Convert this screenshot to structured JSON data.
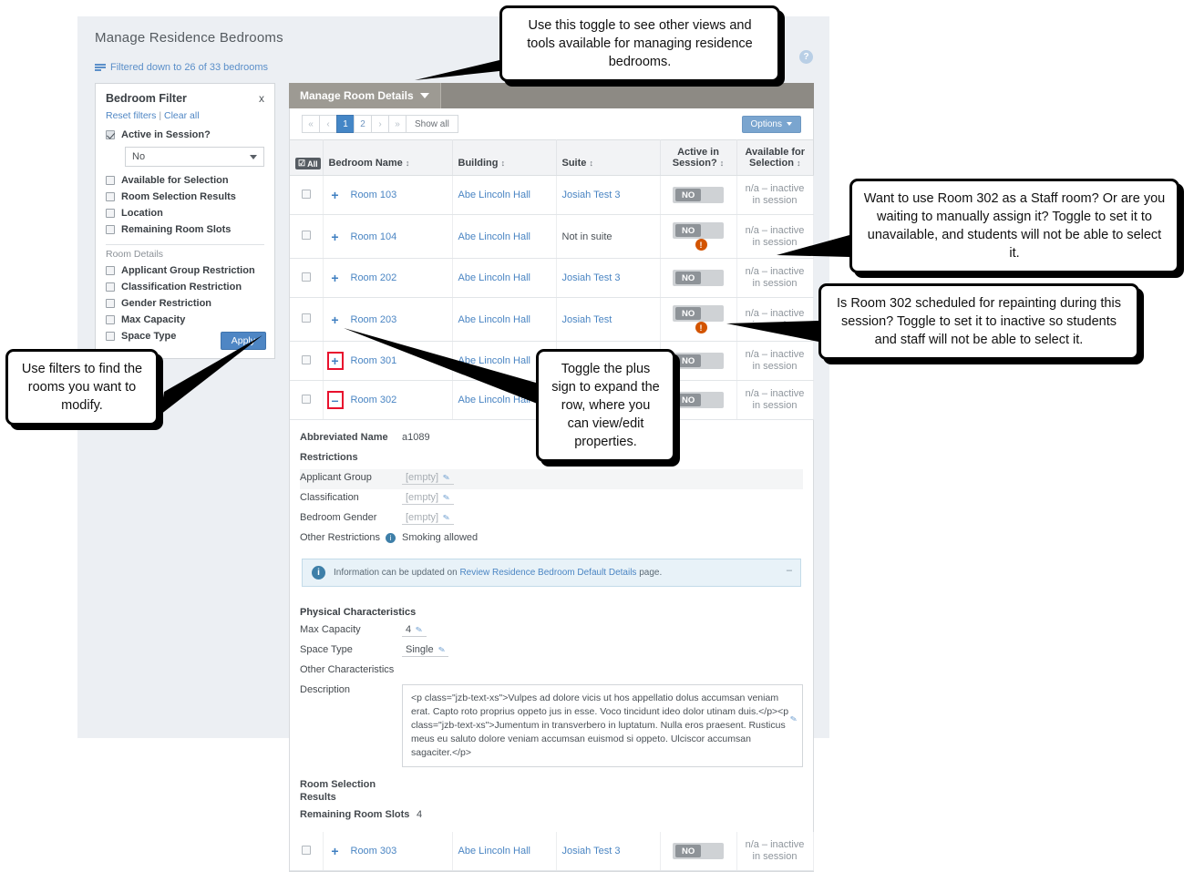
{
  "page": {
    "title": "Manage Residence Bedrooms",
    "filtered_note": "Filtered down to 26 of 33 bedrooms",
    "help_icon": "?"
  },
  "filter_card": {
    "title": "Bedroom Filter",
    "close_label": "x",
    "reset_label": "Reset filters",
    "separator": "|",
    "clear_label": "Clear all",
    "active_in_session": {
      "label": "Active in Session?",
      "checked": true,
      "value": "No"
    },
    "checkboxes": [
      {
        "label": "Available for Selection",
        "checked": false
      },
      {
        "label": "Room Selection Results",
        "checked": false
      },
      {
        "label": "Location",
        "checked": false
      },
      {
        "label": "Remaining Room Slots",
        "checked": false
      }
    ],
    "group_title": "Room Details",
    "detail_checkboxes": [
      {
        "label": "Applicant Group Restriction",
        "checked": false
      },
      {
        "label": "Classification Restriction",
        "checked": false
      },
      {
        "label": "Gender Restriction",
        "checked": false
      },
      {
        "label": "Max Capacity",
        "checked": false
      },
      {
        "label": "Space Type",
        "checked": false
      }
    ],
    "apply_label": "Apply"
  },
  "view_tab": {
    "label": "Manage Room Details"
  },
  "toolbar": {
    "pager": [
      {
        "label": "«",
        "state": "dim"
      },
      {
        "label": "‹",
        "state": "dim"
      },
      {
        "label": "1",
        "state": "active"
      },
      {
        "label": "2",
        "state": "normal"
      },
      {
        "label": "›",
        "state": "dim"
      },
      {
        "label": "»",
        "state": "dim"
      },
      {
        "label": "Show all",
        "state": "showall"
      }
    ],
    "options_label": "Options"
  },
  "grid": {
    "select_all_label": "All",
    "columns": [
      "Bedroom Name",
      "Building",
      "Suite",
      "Active in Session?",
      "Available for Selection"
    ],
    "rows": [
      {
        "expander": "+",
        "name": "Room 103",
        "building": "Abe Lincoln Hall",
        "suite": "Josiah Test 3",
        "suite_link": true,
        "toggle": "NO",
        "warn": false,
        "available": "n/a – inactive in session",
        "highlight_expander": false
      },
      {
        "expander": "+",
        "name": "Room 104",
        "building": "Abe Lincoln Hall",
        "suite": "Not in suite",
        "suite_link": false,
        "toggle": "NO",
        "warn": true,
        "available": "n/a – inactive in session",
        "highlight_expander": false
      },
      {
        "expander": "+",
        "name": "Room 202",
        "building": "Abe Lincoln Hall",
        "suite": "Josiah Test 3",
        "suite_link": true,
        "toggle": "NO",
        "warn": false,
        "available": "n/a – inactive in session",
        "highlight_expander": false
      },
      {
        "expander": "+",
        "name": "Room 203",
        "building": "Abe Lincoln Hall",
        "suite": "Josiah Test",
        "suite_link": true,
        "toggle": "NO",
        "warn": true,
        "available": "n/a – inactive in session",
        "highlight_expander": false
      },
      {
        "expander": "+",
        "name": "Room 301",
        "building": "Abe Lincoln Hall",
        "suite": "Josiah Test 3",
        "suite_link": true,
        "toggle": "NO",
        "warn": false,
        "available": "n/a – inactive in session",
        "highlight_expander": true
      },
      {
        "expander": "–",
        "name": "Room 302",
        "building": "Abe Lincoln Hall",
        "suite": "Josiah Test 3",
        "suite_link": true,
        "toggle": "NO",
        "warn": false,
        "available": "n/a – inactive in session",
        "highlight_expander": true
      }
    ],
    "last_row": {
      "expander": "+",
      "name": "Room 303",
      "building": "Abe Lincoln Hall",
      "suite": "Josiah Test 3",
      "toggle": "NO",
      "available": "n/a – inactive in session"
    }
  },
  "detail": {
    "abbrev_label": "Abbreviated Name",
    "abbrev_value": "a1089",
    "restrictions_header": "Restrictions",
    "restriction_rows": [
      {
        "label": "Applicant Group",
        "value": "[empty]"
      },
      {
        "label": "Classification",
        "value": "[empty]"
      },
      {
        "label": "Bedroom Gender",
        "value": "[empty]"
      }
    ],
    "other_restrictions_label": "Other Restrictions",
    "other_restrictions_value": "Smoking allowed",
    "info_banner": {
      "prefix": "Information can be updated on ",
      "link": "Review Residence Bedroom Default Details",
      "suffix": " page.",
      "collapse": "–"
    },
    "physical_header": "Physical Characteristics",
    "max_capacity_label": "Max Capacity",
    "max_capacity_value": "4",
    "space_type_label": "Space Type",
    "space_type_value": "Single",
    "other_characteristics_header": "Other Characteristics",
    "description_label": "Description",
    "description_value": "<p class=\"jzb-text-xs\">Vulpes ad dolore vicis ut hos appellatio dolus accumsan veniam erat. Capto roto proprius oppeto jus in esse. Voco tincidunt ideo dolor utinam duis.</p><p class=\"jzb-text-xs\">Jumentum in transverbero in luptatum. Nulla eros praesent. Rusticus meus eu saluto dolore veniam accumsan euismod si oppeto. Ulciscor accumsan sagaciter.</p>",
    "room_selection_results_header": "Room Selection Results",
    "remaining_slots_label": "Remaining Room Slots",
    "remaining_slots_value": "4"
  },
  "callouts": {
    "toggle_views": "Use this toggle to see other views and tools available for managing residence bedrooms.",
    "staff_room": "Want to use Room 302 as a Staff room? Or are you waiting to manually assign it? Toggle to set it to unavailable, and students will not be able to select it.",
    "repainting": "Is Room 302 scheduled for repainting during this session? Toggle to set it to inactive so students and staff will not be able to select it.",
    "expand_row": "Toggle the plus sign to expand the row, where you can view/edit properties.",
    "use_filters": "Use filters to find the rooms you want to modify."
  },
  "colors": {
    "link": "#4a85c3",
    "primary_button": "#4e86c4",
    "tab_bar": "#8d8a84",
    "warning": "#d35400",
    "highlight_outline": "#e8112d"
  }
}
